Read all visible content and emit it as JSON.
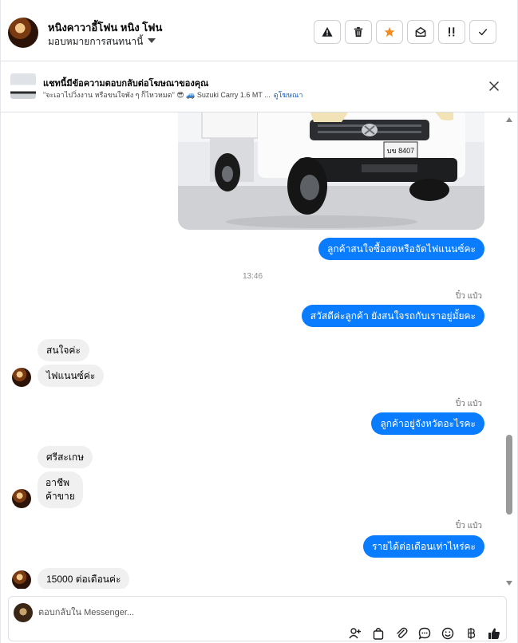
{
  "header": {
    "contact_name": "หนิงคาวาอี้โฟน หนิง โฟน",
    "assign_label": "มอบหมายการสนทนานี้",
    "actions": [
      {
        "name": "report-button",
        "icon": "warning-icon"
      },
      {
        "name": "delete-button",
        "icon": "trash-icon"
      },
      {
        "name": "star-button",
        "icon": "star-icon"
      },
      {
        "name": "mark-unread-button",
        "icon": "envelope-open-icon"
      },
      {
        "name": "follow-up-button",
        "icon": "exclamation-icon"
      },
      {
        "name": "done-button",
        "icon": "check-icon"
      }
    ]
  },
  "ad_banner": {
    "title": "แชทนี้มีข้อความตอบกลับต่อโฆษณาของคุณ",
    "subtitle": "\"จะเอาไปวิ่งงาน หรือขนใจพัง ๆ ก็ไหวหมด\" 😎 🚙 Suzuki Carry 1.6 MT ...",
    "link": "ดูโฆษณา"
  },
  "photo": {
    "plate_text": "บข 8407"
  },
  "messages": [
    {
      "dir": "out",
      "text": "ลูกค้าสนใจซื้อสดหรือจัดไฟแนนซ์คะ"
    },
    {
      "type": "timestamp",
      "text": "13:46"
    },
    {
      "dir": "out",
      "sender": "ปิ๋ว แป๋ว",
      "text": "สวัสดีค่ะลูกค้า ยังสนใจรถกับเราอยู่มั้ยคะ"
    },
    {
      "dir": "in",
      "text": "สนใจค่ะ"
    },
    {
      "dir": "in",
      "text": "ไฟแนนซ์ค่ะ"
    },
    {
      "dir": "out",
      "sender": "ปิ๋ว แป๋ว",
      "text": "ลูกค้าอยู่จังหวัดอะไรคะ"
    },
    {
      "dir": "in",
      "text": "ศรีสะเกษ"
    },
    {
      "dir": "in",
      "text": "อาชีพ\nค้าขาย"
    },
    {
      "dir": "out",
      "sender": "ปิ๋ว แป๋ว",
      "text": "รายได้ต่อเดือนเท่าไหร่คะ"
    },
    {
      "dir": "in",
      "text": "15000 ต่อเดือนค่ะ"
    }
  ],
  "composer": {
    "placeholder": "ตอบกลับใน Messenger...",
    "tools": [
      "add-person-icon",
      "bag-icon",
      "paperclip-icon",
      "chat-bubble-icon",
      "emoji-icon",
      "baht-icon",
      "thumbs-up-icon"
    ]
  },
  "colors": {
    "outgoing_bubble": "#0a7cff",
    "incoming_bubble": "#f0f0f0",
    "star_active": "#f28a1e",
    "link": "#1a5fb4"
  }
}
